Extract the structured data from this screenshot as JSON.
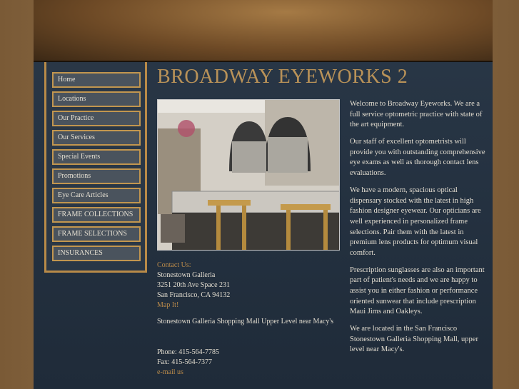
{
  "site": {
    "title": "BROADWAY EYEWORKS 2"
  },
  "nav": {
    "items": [
      {
        "label": "Home"
      },
      {
        "label": "Locations"
      },
      {
        "label": "Our Practice"
      },
      {
        "label": "Our Services"
      },
      {
        "label": "Special Events"
      },
      {
        "label": "Promotions"
      },
      {
        "label": "Eye Care Articles"
      },
      {
        "label": "FRAME COLLECTIONS"
      },
      {
        "label": "FRAME SELECTIONS"
      },
      {
        "label": "INSURANCES"
      }
    ]
  },
  "contact": {
    "heading": "Contact Us:",
    "name": "Stonestown Galleria",
    "address1": "3251 20th Ave Space 231",
    "address2": "San Francisco, CA 94132",
    "map_link": "Map It!",
    "note": "Stonestown Galleria Shopping Mall Upper Level near Macy's",
    "phone": "Phone: 415-564-7785",
    "fax": "Fax: 415-564-7377",
    "email_link": "e-mail us"
  },
  "intro": {
    "paragraphs": [
      "Welcome to Broadway Eyeworks. We are a full service optometric practice with state of the art equipment.",
      "Our staff of excellent optometrists will provide you with outstanding comprehensive eye exams as well as thorough contact lens evaluations.",
      "We have a modern, spacious optical dispensary stocked with the latest in high fashion designer eyewear. Our opticians are well experienced in personalized frame selections. Pair them with the latest in premium lens products for optimum visual comfort.",
      "Prescription sunglasses are also an important part of patient's needs and we are happy to assist you in either fashion or performance oriented sunwear that include prescription Maui Jims and Oakleys.",
      "We are located in the San Francisco Stonestown Galleria Shopping Mall, upper level near Macy's."
    ]
  },
  "colors": {
    "accent": "#b98a4a",
    "title": "#b99258",
    "page_bg": "#23303f",
    "nav_bg": "#4a535d",
    "nav_border": "#c2964f"
  },
  "icons": {
    "photo": "store-interior-photo"
  }
}
